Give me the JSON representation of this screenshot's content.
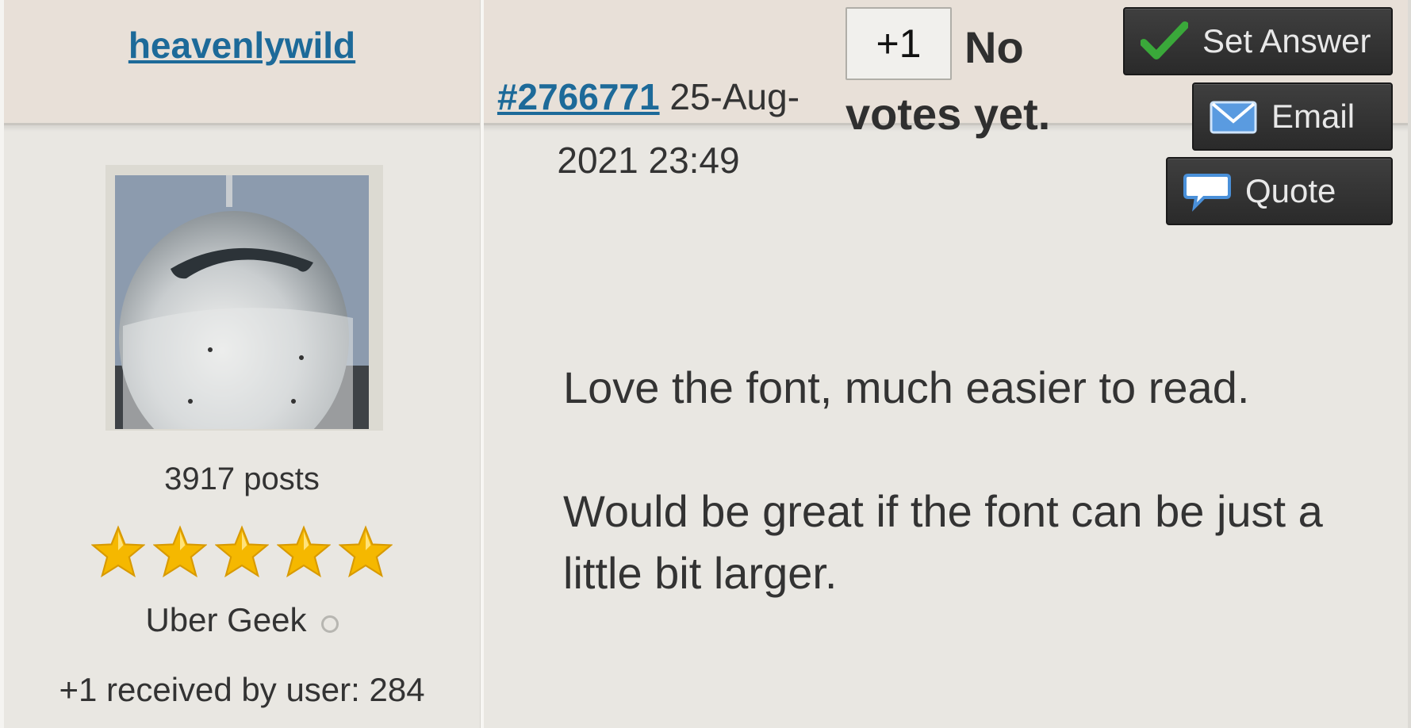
{
  "user": {
    "username": "heavenlywild",
    "post_count": "3917 posts",
    "star_rating": 5,
    "rank": "Uber Geek",
    "received": "+1 received by user: 284"
  },
  "post": {
    "id": "#2766771",
    "date": "25-Aug-2021 23:49",
    "vote_button": "+1",
    "vote_status": "No votes yet.",
    "body": [
      "Love the font, much easier to read.",
      "Would be great if the font can be just a little bit larger."
    ]
  },
  "actions": {
    "set_answer": "Set Answer",
    "email": "Email",
    "quote": "Quote"
  },
  "colors": {
    "link": "#1d6a99",
    "header_band": "#e8e0d8",
    "background": "#e9e7e2",
    "button_dark": "#333333",
    "check_green": "#3aa83a",
    "email_blue": "#4a90d9",
    "star_gold": "#f5b800"
  },
  "icons": [
    "check-icon",
    "envelope-icon",
    "speech-bubble-icon",
    "star-icon",
    "status-dot-icon"
  ]
}
